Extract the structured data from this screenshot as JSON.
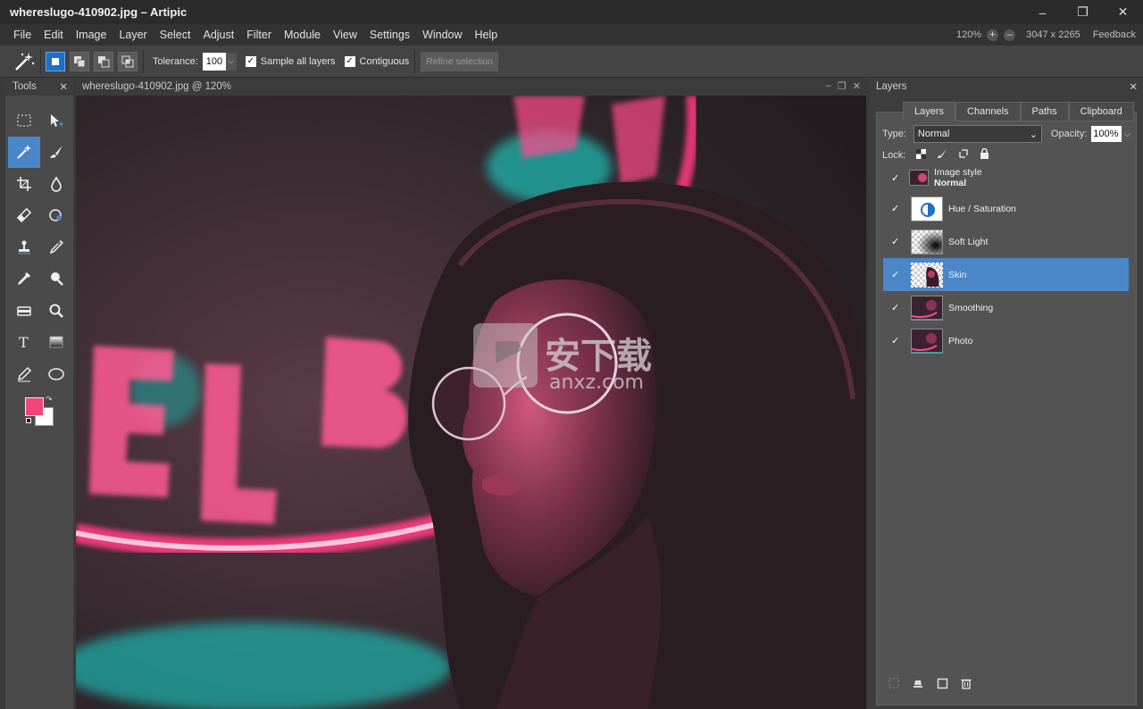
{
  "window": {
    "title": "whereslugo-410902.jpg – Artipic"
  },
  "menu": [
    "File",
    "Edit",
    "Image",
    "Layer",
    "Select",
    "Adjust",
    "Filter",
    "Module",
    "View",
    "Settings",
    "Window",
    "Help"
  ],
  "status": {
    "zoom": "120%",
    "dimensions": "3047 x 2265",
    "feedback": "Feedback"
  },
  "options": {
    "tolerance_label": "Tolerance:",
    "tolerance_value": "100",
    "sample_all_layers": "Sample all layers",
    "contiguous": "Contiguous",
    "refine_selection": "Refine selection"
  },
  "tools_panel": {
    "title": "Tools"
  },
  "document": {
    "tab": "whereslugo-410902.jpg @ 120%"
  },
  "layers_panel": {
    "title": "Layers",
    "tabs": [
      "Layers",
      "Channels",
      "Paths",
      "Clipboard"
    ],
    "type_label": "Type:",
    "type_value": "Normal",
    "opacity_label": "Opacity:",
    "opacity_value": "100%",
    "lock_label": "Lock:",
    "layers": [
      {
        "name": "Image style",
        "sub": "Normal",
        "visible": true,
        "selected": false
      },
      {
        "name": "Hue / Saturation",
        "visible": true,
        "selected": false
      },
      {
        "name": "Soft Light",
        "visible": true,
        "selected": false
      },
      {
        "name": "Skin",
        "visible": true,
        "selected": true
      },
      {
        "name": "Smoothing",
        "visible": true,
        "selected": false
      },
      {
        "name": "Photo",
        "visible": true,
        "selected": false
      }
    ]
  },
  "colors": {
    "accent": "#4b86c8",
    "foreground": "#f0457a",
    "background": "#ffffff"
  }
}
